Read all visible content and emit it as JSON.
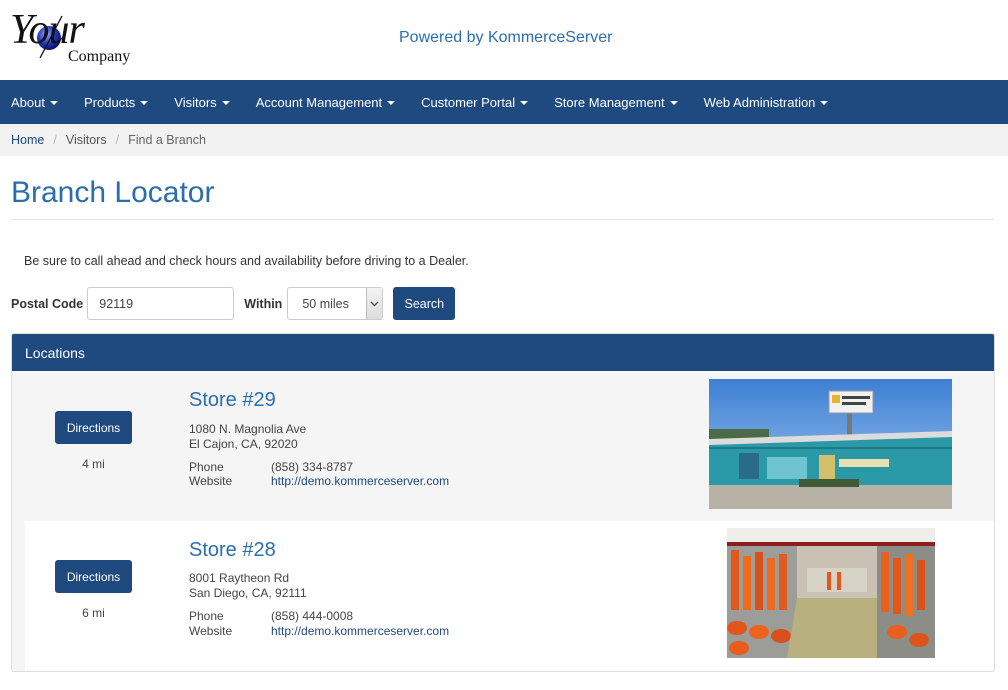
{
  "brand": {
    "logo_your": "Your",
    "logo_company": "Company",
    "powered_by": "Powered by KommerceServer"
  },
  "nav": {
    "items": [
      {
        "label": "About"
      },
      {
        "label": "Products"
      },
      {
        "label": "Visitors"
      },
      {
        "label": "Account Management"
      },
      {
        "label": "Customer Portal"
      },
      {
        "label": "Store Management"
      },
      {
        "label": "Web Administration"
      }
    ]
  },
  "breadcrumb": {
    "home": "Home",
    "visitors": "Visitors",
    "current": "Find a Branch"
  },
  "page": {
    "title": "Branch Locator",
    "notice": "Be sure to call ahead and check hours and availability before driving to a Dealer."
  },
  "search": {
    "postal_label": "Postal Code",
    "postal_value": "92119",
    "within_label": "Within",
    "within_value": "50 miles",
    "search_button": "Search"
  },
  "locations": {
    "heading": "Locations",
    "stores": [
      {
        "name": "Store #29",
        "address_line1": "1080 N. Magnolia Ave",
        "address_line2": "El Cajon, CA, 92020",
        "phone_label": "Phone",
        "phone": "(858) 334-8787",
        "website_label": "Website",
        "website": "http://demo.kommerceserver.com",
        "directions_label": "Directions",
        "distance": "4 mi"
      },
      {
        "name": "Store #28",
        "address_line1": "8001 Raytheon Rd",
        "address_line2": "San Diego, CA, 92111",
        "phone_label": "Phone",
        "phone": "(858) 444-0008",
        "website_label": "Website",
        "website": "http://demo.kommerceserver.com",
        "directions_label": "Directions",
        "distance": "6 mi"
      }
    ]
  },
  "colors": {
    "navy": "#1e4a80",
    "link_blue": "#2a6ead"
  }
}
